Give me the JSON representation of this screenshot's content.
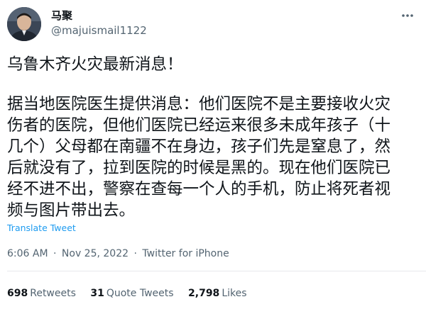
{
  "author": {
    "display_name": "马聚",
    "handle": "@majuismail1122"
  },
  "tweet": {
    "headline": "乌鲁木齐火灾最新消息！",
    "body_lines": [
      "据当地医院医生提供消息：他们医院不是主要接收火灾",
      "伤者的医院，但他们医院已经运来很多未成年孩子（十",
      "几个）父母都在南疆不在身边，孩子们先是窒息了，然",
      "后就没有了，拉到医院的时候是黑的。现在他们医院已",
      "经不进不出，警察在查每一个人的手机，防止将死者视",
      "频与图片带出去。"
    ],
    "translate_label": "Translate Tweet",
    "time": "6:06 AM",
    "date": "Nov 25, 2022",
    "source": "Twitter for iPhone",
    "separator": "·"
  },
  "stats": {
    "retweets": {
      "count": "698",
      "label": "Retweets"
    },
    "quote_tweets": {
      "count": "31",
      "label": "Quote Tweets"
    },
    "likes": {
      "count": "2,798",
      "label": "Likes"
    }
  },
  "icons": {
    "more": "more-dots-icon",
    "avatar": "profile-avatar"
  },
  "colors": {
    "link": "#1d9bf0",
    "secondary_text": "#536471",
    "primary_text": "#0f1419",
    "divider": "#e7e9ec"
  }
}
